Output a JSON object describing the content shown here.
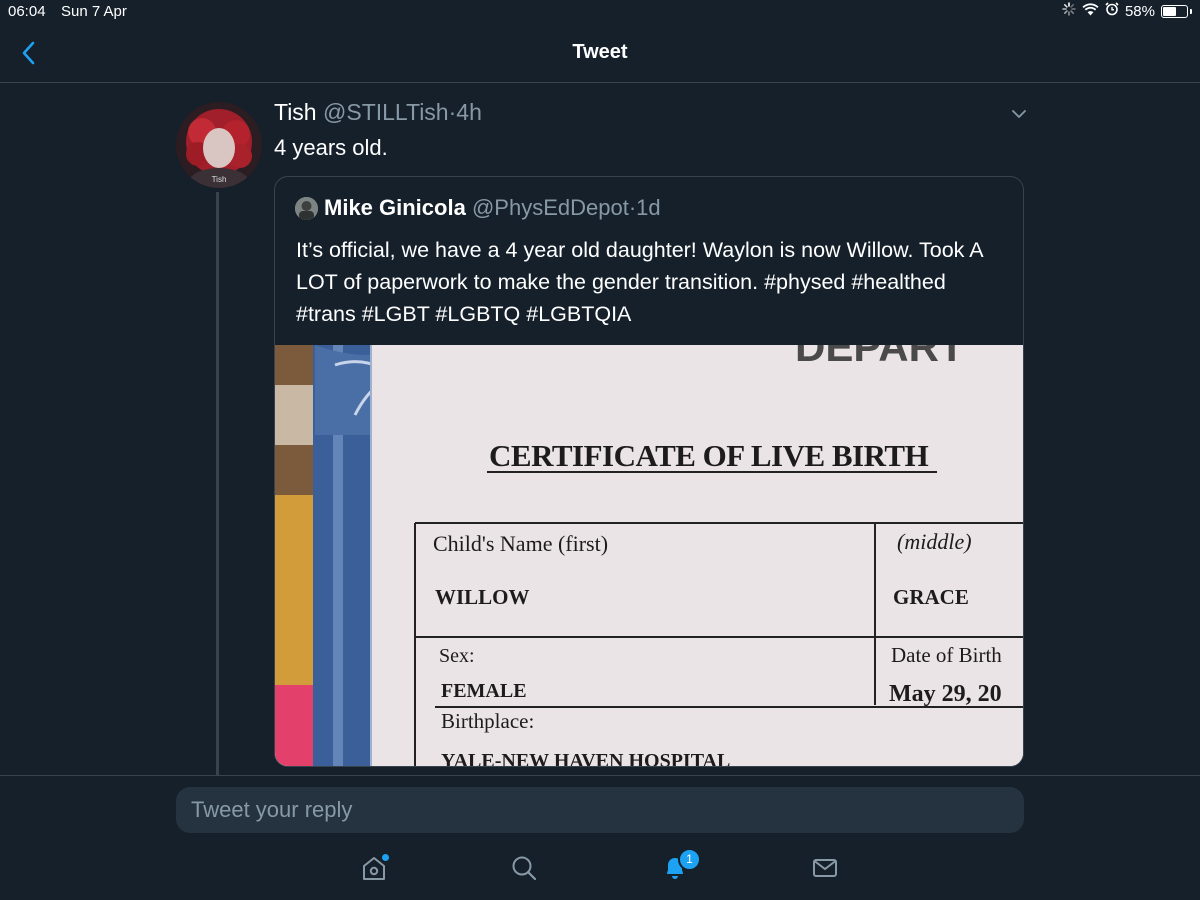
{
  "status_bar": {
    "time": "06:04",
    "date": "Sun 7 Apr",
    "battery": "58%",
    "battery_level": 0.58
  },
  "header": {
    "title": "Tweet"
  },
  "tweet": {
    "author_name": "Tish",
    "author_handle": "@STILLTish",
    "separator": "·",
    "time_ago": "4h",
    "text": "4 years old.",
    "avatar_caption": "Tish"
  },
  "quoted_tweet": {
    "author_name": "Mike Ginicola",
    "author_handle": "@PhysEdDepot",
    "separator": "·",
    "time_ago": "1d",
    "text": "It’s official, we have a 4 year old daughter! Waylon is now Willow. Took A LOT of paperwork to make the gender transition. #physed #healthed #trans #LGBT #LGBTQ #LGBTQIA",
    "media": {
      "header_fragment": "DEPART",
      "title": "CERTIFICATE OF LIVE BIRTH",
      "childs_name_label": "Child's Name (first)",
      "middle_label": "(middle)",
      "first_name": "WILLOW",
      "middle_name": "GRACE",
      "sex_label": "Sex:",
      "sex_value": "FEMALE",
      "dob_label": "Date of Birth",
      "dob_value": "May 29, 20",
      "birthplace_label": "Birthplace:",
      "birthplace_value": "YALE-NEW HAVEN HOSPITAL"
    }
  },
  "reply": {
    "placeholder": "Tweet your reply"
  },
  "tab_bar": {
    "notifications_badge": "1",
    "tabs": [
      "home-icon",
      "search-icon",
      "notifications-icon",
      "messages-icon"
    ]
  },
  "colors": {
    "background": "#15202b",
    "border": "#38444d",
    "accent": "#1da1f2",
    "secondary_text": "#8899a6",
    "input_bg": "#253341"
  }
}
